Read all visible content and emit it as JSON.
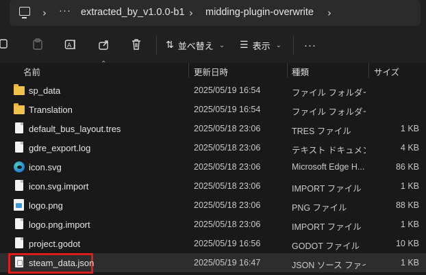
{
  "address_bar": {
    "more": "···",
    "crumbs": [
      "extracted_by_v1.0.0-b1",
      "midding-plugin-overwrite"
    ]
  },
  "toolbar": {
    "sort_label": "並べ替え",
    "view_label": "表示",
    "more": "···"
  },
  "columns": {
    "name": "名前",
    "date": "更新日時",
    "type": "種類",
    "size": "サイズ"
  },
  "files": [
    {
      "name": "sp_data",
      "date": "2025/05/19 16:54",
      "type": "ファイル フォルダー",
      "size": "",
      "icon": "folder-icon"
    },
    {
      "name": "Translation",
      "date": "2025/05/19 16:54",
      "type": "ファイル フォルダー",
      "size": "",
      "icon": "folder-icon"
    },
    {
      "name": "default_bus_layout.tres",
      "date": "2025/05/18 23:06",
      "type": "TRES ファイル",
      "size": "1 KB",
      "icon": "file-icon"
    },
    {
      "name": "gdre_export.log",
      "date": "2025/05/18 23:06",
      "type": "テキスト ドキュメント",
      "size": "4 KB",
      "icon": "file-icon"
    },
    {
      "name": "icon.svg",
      "date": "2025/05/18 23:06",
      "type": "Microsoft Edge H...",
      "size": "86 KB",
      "icon": "edge-icon"
    },
    {
      "name": "icon.svg.import",
      "date": "2025/05/18 23:06",
      "type": "IMPORT ファイル",
      "size": "1 KB",
      "icon": "file-icon"
    },
    {
      "name": "logo.png",
      "date": "2025/05/18 23:06",
      "type": "PNG ファイル",
      "size": "88 KB",
      "icon": "image-icon"
    },
    {
      "name": "logo.png.import",
      "date": "2025/05/18 23:06",
      "type": "IMPORT ファイル",
      "size": "1 KB",
      "icon": "file-icon"
    },
    {
      "name": "project.godot",
      "date": "2025/05/19 16:56",
      "type": "GODOT ファイル",
      "size": "10 KB",
      "icon": "file-icon"
    },
    {
      "name": "steam_data.json",
      "date": "2025/05/19 16:47",
      "type": "JSON ソース ファイル",
      "size": "1 KB",
      "icon": "json-icon",
      "selected": true
    }
  ],
  "colors": {
    "highlight": "#e01b1b",
    "folder": "#f0c24b"
  }
}
